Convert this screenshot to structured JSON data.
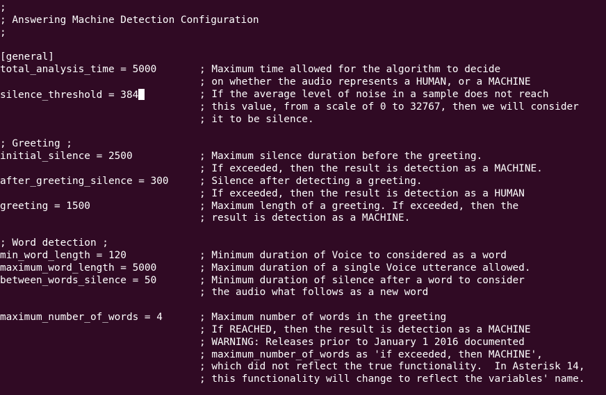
{
  "lines": [
    {
      "code": ";",
      "comment": ""
    },
    {
      "code": "; Answering Machine Detection Configuration",
      "comment": ""
    },
    {
      "code": ";",
      "comment": ""
    },
    {
      "code": "",
      "comment": ""
    },
    {
      "code": "[general]",
      "comment": ""
    },
    {
      "code": "total_analysis_time = 5000",
      "comment": "; Maximum time allowed for the algorithm to decide"
    },
    {
      "code": "",
      "comment": "; on whether the audio represents a HUMAN, or a MACHINE"
    },
    {
      "code": "silence_threshold = 384",
      "comment": "; If the average level of noise in a sample does not reach",
      "cursor": true
    },
    {
      "code": "",
      "comment": "; this value, from a scale of 0 to 32767, then we will consider"
    },
    {
      "code": "",
      "comment": "; it to be silence."
    },
    {
      "code": "",
      "comment": ""
    },
    {
      "code": "; Greeting ;",
      "comment": ""
    },
    {
      "code": "initial_silence = 2500",
      "comment": "; Maximum silence duration before the greeting."
    },
    {
      "code": "",
      "comment": "; If exceeded, then the result is detection as a MACHINE."
    },
    {
      "code": "after_greeting_silence = 300",
      "comment": "; Silence after detecting a greeting."
    },
    {
      "code": "",
      "comment": "; If exceeded, then the result is detection as a HUMAN"
    },
    {
      "code": "greeting = 1500",
      "comment": "; Maximum length of a greeting. If exceeded, then the"
    },
    {
      "code": "",
      "comment": "; result is detection as a MACHINE."
    },
    {
      "code": "",
      "comment": ""
    },
    {
      "code": "; Word detection ;",
      "comment": ""
    },
    {
      "code": "min_word_length = 120",
      "comment": "; Minimum duration of Voice to considered as a word"
    },
    {
      "code": "maximum_word_length = 5000",
      "comment": "; Maximum duration of a single Voice utterance allowed."
    },
    {
      "code": "between_words_silence = 50",
      "comment": "; Minimum duration of silence after a word to consider"
    },
    {
      "code": "",
      "comment": "; the audio what follows as a new word"
    },
    {
      "code": "",
      "comment": ""
    },
    {
      "code": "maximum_number_of_words = 4",
      "comment": "; Maximum number of words in the greeting"
    },
    {
      "code": "",
      "comment": "; If REACHED, then the result is detection as a MACHINE"
    },
    {
      "code": "",
      "comment": "; WARNING: Releases prior to January 1 2016 documented"
    },
    {
      "code": "",
      "comment": "; maximum_number_of_words as 'if exceeded, then MACHINE',"
    },
    {
      "code": "",
      "comment": "; which did not reflect the true functionality.  In Asterisk 14,"
    },
    {
      "code": "",
      "comment": "; this functionality will change to reflect the variables' name."
    }
  ]
}
